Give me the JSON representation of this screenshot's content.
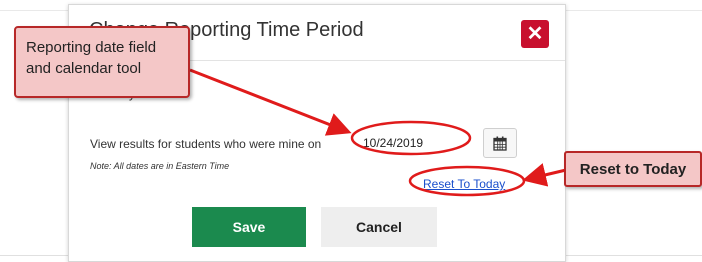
{
  "dialog": {
    "title": "Change Reporting Time Period",
    "close_icon": "close-x-icon",
    "schoolyear_label": "School year: ",
    "view_results_label": "View results for students who were mine on",
    "date_value": "10/24/2019",
    "calendar_icon": "calendar-icon",
    "note": "Note: All dates are in Eastern Time",
    "reset_link": "Reset To Today",
    "save_label": "Save",
    "cancel_label": "Cancel"
  },
  "annotations": {
    "date_field_callout": "Reporting date field and calendar tool",
    "reset_callout": "Reset to Today"
  },
  "colors": {
    "close_button": "#c8102e",
    "save_button": "#1b8a4e",
    "cancel_button": "#eeeeee",
    "link": "#1a4fcc",
    "callout_fill": "#f4c7c7",
    "callout_border": "#b72828",
    "annotation_red": "#e01b1b"
  }
}
